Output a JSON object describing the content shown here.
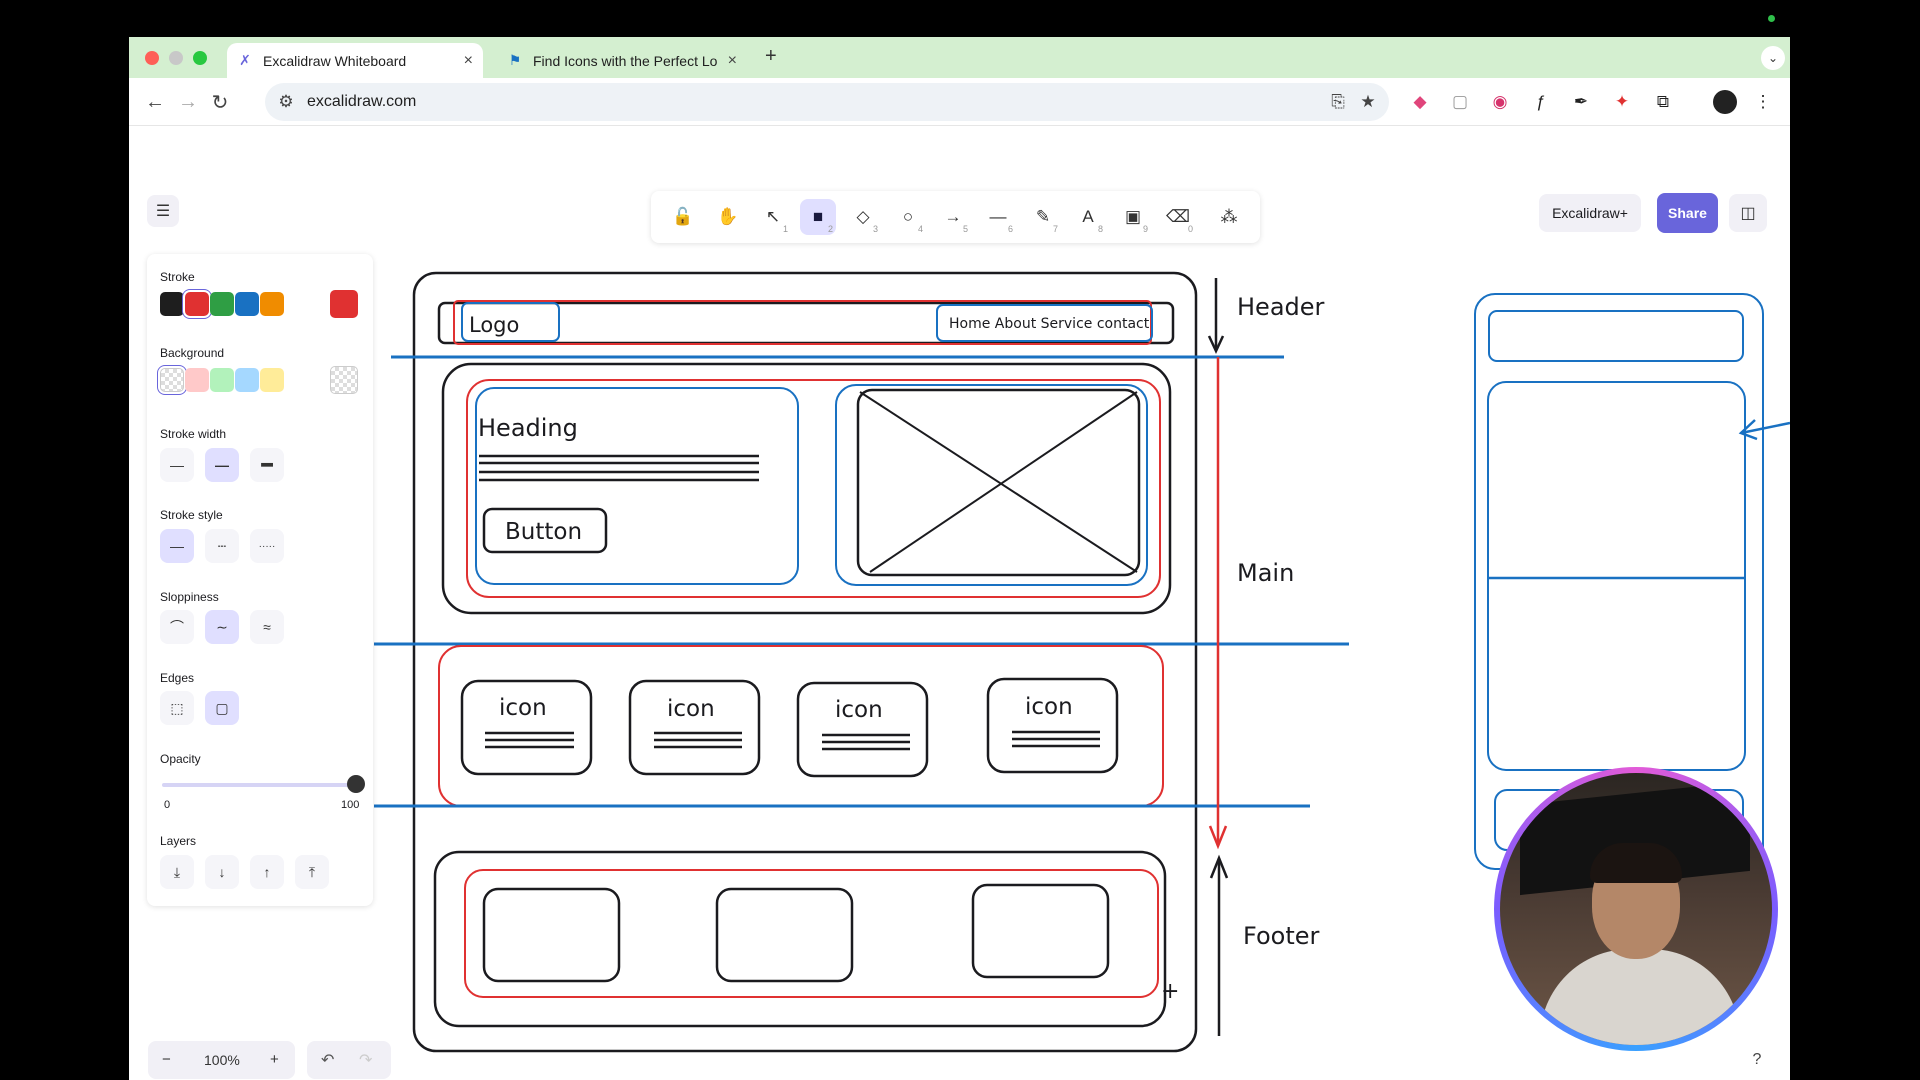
{
  "browser": {
    "tabs": [
      {
        "title": "Excalidraw Whiteboard",
        "icon": "excalidraw-favicon",
        "active": true
      },
      {
        "title": "Find Icons with the Perfect Lo",
        "icon": "flag-favicon",
        "active": false
      }
    ],
    "new_tab": "+",
    "url": "excalidraw.com"
  },
  "toolbar": {
    "tools": [
      {
        "name": "lock",
        "glyph": "🔓",
        "key": ""
      },
      {
        "name": "hand",
        "glyph": "✋",
        "key": ""
      },
      {
        "name": "selection",
        "glyph": "↖",
        "key": "1"
      },
      {
        "name": "rectangle",
        "glyph": "■",
        "key": "2",
        "active": true
      },
      {
        "name": "diamond",
        "glyph": "◇",
        "key": "3"
      },
      {
        "name": "ellipse",
        "glyph": "○",
        "key": "4"
      },
      {
        "name": "arrow",
        "glyph": "→",
        "key": "5"
      },
      {
        "name": "line",
        "glyph": "—",
        "key": "6"
      },
      {
        "name": "draw",
        "glyph": "✎",
        "key": "7"
      },
      {
        "name": "text",
        "glyph": "A",
        "key": "8"
      },
      {
        "name": "image",
        "glyph": "▣",
        "key": "9"
      },
      {
        "name": "eraser",
        "glyph": "⌫",
        "key": "0"
      },
      {
        "name": "more-tools",
        "glyph": "⁂",
        "key": ""
      }
    ],
    "plus_label": "Excalidraw+",
    "share_label": "Share"
  },
  "properties": {
    "stroke_label": "Stroke",
    "stroke_colors": [
      "#1e1e1e",
      "#e03131",
      "#2f9e44",
      "#1971c2",
      "#f08c00"
    ],
    "stroke_current": "#e03131",
    "background_label": "Background",
    "background_colors": [
      "transparent",
      "#ffc9c9",
      "#b2f2bb",
      "#a5d8ff",
      "#ffec99"
    ],
    "stroke_width_label": "Stroke width",
    "stroke_style_label": "Stroke style",
    "sloppiness_label": "Sloppiness",
    "edges_label": "Edges",
    "opacity_label": "Opacity",
    "opacity_min": "0",
    "opacity_max": "100",
    "opacity_value": 100,
    "layers_label": "Layers"
  },
  "zoom": {
    "minus": "−",
    "level": "100%",
    "plus": "+"
  },
  "history": {
    "undo": "↶",
    "redo": "↷"
  },
  "canvas": {
    "logo": "Logo",
    "nav": "Home About Service contact",
    "heading": "Heading",
    "button": "Button",
    "icon_labels": [
      "icon",
      "icon",
      "icon",
      "icon"
    ],
    "section_header": "Header",
    "section_main": "Main",
    "section_footer": "Footer"
  },
  "colors": {
    "accent": "#6965db",
    "red_stroke": "#e03131",
    "blue_stroke": "#1971c2"
  }
}
